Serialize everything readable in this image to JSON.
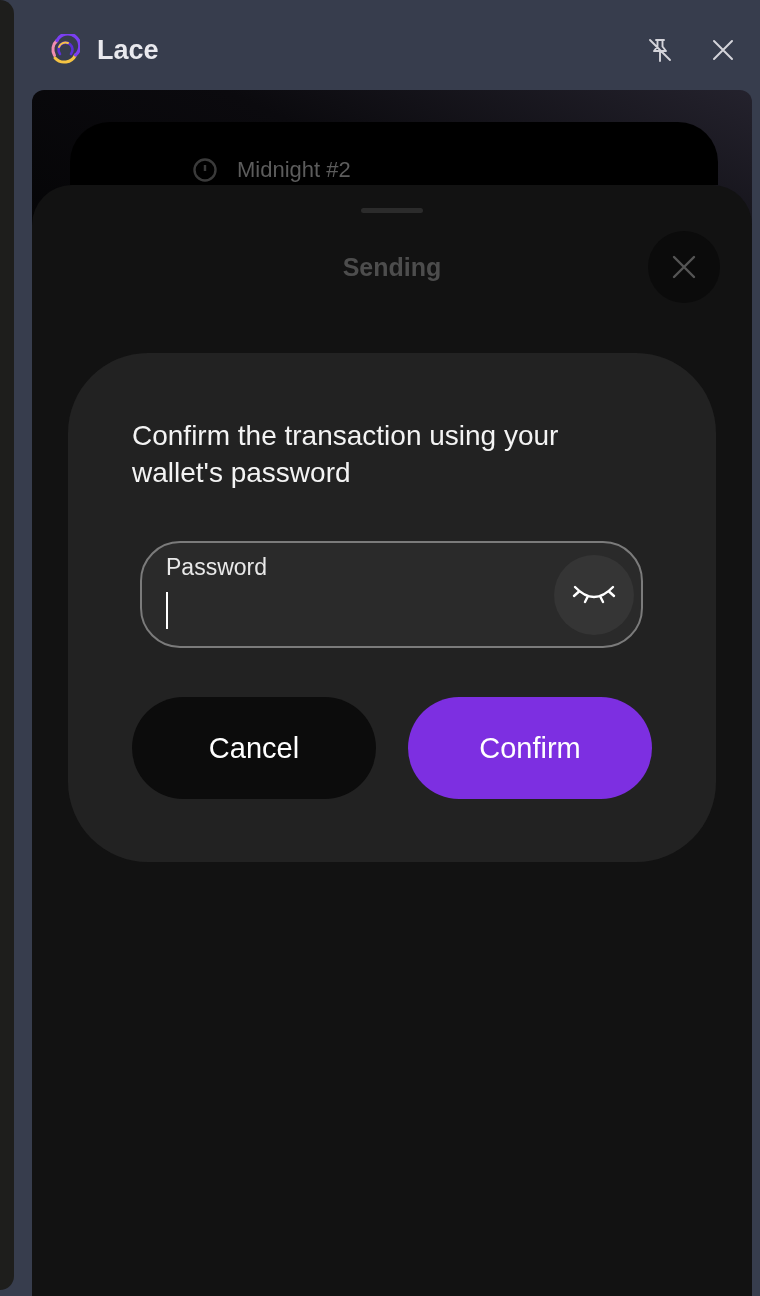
{
  "window": {
    "title": "Lace"
  },
  "backdrop": {
    "wallet_name": "Midnight #2"
  },
  "sheet": {
    "title": "Sending"
  },
  "dialog": {
    "message": "Confirm the transaction using your wallet's password",
    "password_field": {
      "label": "Password",
      "focused": true,
      "visible": false
    },
    "buttons": [
      {
        "label": "Cancel",
        "kind": "secondary"
      },
      {
        "label": "Confirm",
        "kind": "primary"
      }
    ]
  }
}
